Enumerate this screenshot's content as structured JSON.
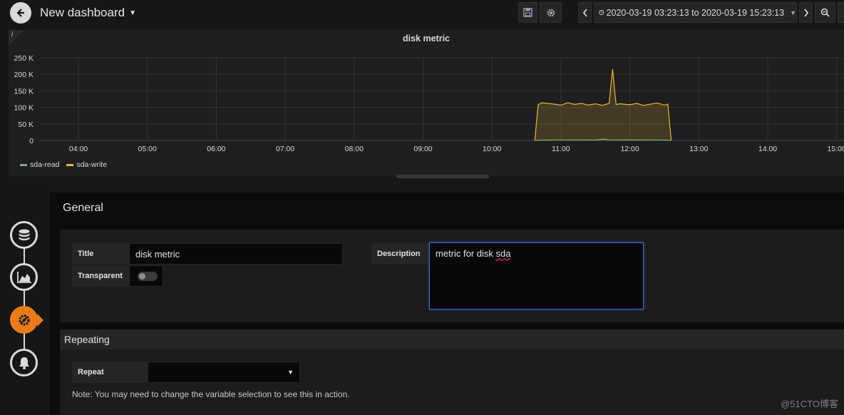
{
  "topbar": {
    "title": "New dashboard",
    "time_range": "2020-03-19 03:23:13 to 2020-03-19 15:23:13",
    "icons": [
      "back-arrow-icon",
      "save-icon",
      "gear-icon",
      "chevron-left-icon",
      "clock-icon",
      "chevron-right-icon",
      "zoom-out-icon"
    ]
  },
  "panel": {
    "info": "i",
    "title": "disk metric"
  },
  "chart_data": {
    "type": "area",
    "title": "disk metric",
    "xlabel": "",
    "ylabel": "",
    "x_ticks": [
      "04:00",
      "05:00",
      "06:00",
      "07:00",
      "08:00",
      "09:00",
      "10:00",
      "11:00",
      "12:00",
      "13:00",
      "14:00",
      "15:00"
    ],
    "y_ticks": [
      "0",
      "50 K",
      "100 K",
      "150 K",
      "200 K",
      "250 K"
    ],
    "ylim": [
      0,
      250000
    ],
    "xlim_hours": [
      3.385,
      15.385
    ],
    "grid": true,
    "legend_position": "bottom-left",
    "series": [
      {
        "name": "sda-read",
        "color": "#7eb26d",
        "x": [
          10.62,
          10.7,
          11.0,
          11.5,
          11.62,
          11.7,
          12.0,
          12.3,
          12.55,
          12.6
        ],
        "values": [
          0,
          1000,
          1500,
          1200,
          4000,
          1500,
          1200,
          1500,
          1000,
          0
        ]
      },
      {
        "name": "sda-write",
        "color": "#eab839",
        "x": [
          10.62,
          10.67,
          10.72,
          10.8,
          10.9,
          11.0,
          11.1,
          11.2,
          11.3,
          11.4,
          11.5,
          11.6,
          11.7,
          11.72,
          11.75,
          11.78,
          11.8,
          11.85,
          11.9,
          12.0,
          12.1,
          12.2,
          12.3,
          12.4,
          12.5,
          12.55,
          12.6
        ],
        "values": [
          0,
          108000,
          114000,
          112000,
          110000,
          107000,
          114000,
          109000,
          112000,
          107000,
          111000,
          106000,
          112000,
          155000,
          215000,
          150000,
          108000,
          111000,
          110000,
          108000,
          112000,
          106000,
          110000,
          113000,
          107000,
          110000,
          0
        ]
      }
    ]
  },
  "editor": {
    "steps": [
      {
        "name": "queries",
        "icon": "database-icon",
        "active": false
      },
      {
        "name": "visualization",
        "icon": "area-chart-icon",
        "active": false
      },
      {
        "name": "general",
        "icon": "gear-wrench-icon",
        "active": true
      },
      {
        "name": "alert",
        "icon": "bell-icon",
        "active": false
      }
    ],
    "general": {
      "header": "General",
      "title_label": "Title",
      "title_value": "disk metric",
      "transparent_label": "Transparent",
      "transparent_on": false,
      "description_label": "Description",
      "description_value_prefix": "metric for disk ",
      "description_value_misspelled": "sda"
    },
    "repeating": {
      "header": "Repeating",
      "repeat_label": "Repeat",
      "repeat_value": "",
      "note": "Note: You may need to change the variable selection to see this in action."
    }
  },
  "watermark": "@51CTO博客"
}
